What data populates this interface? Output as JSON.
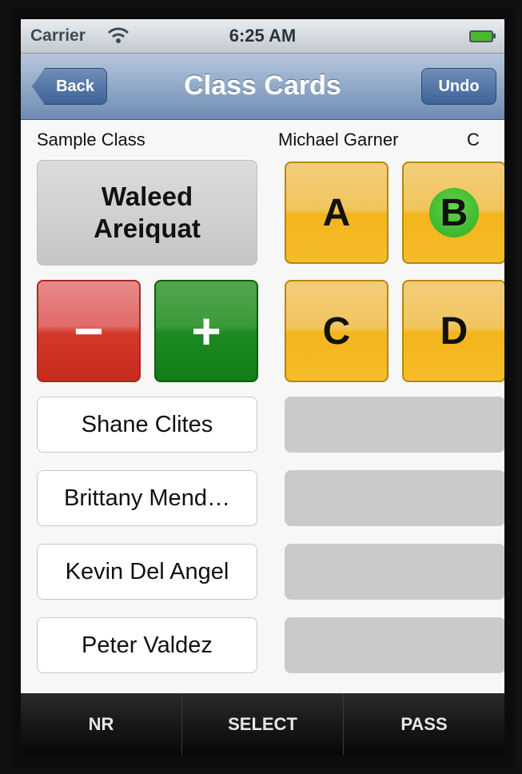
{
  "status_bar": {
    "carrier": "Carrier",
    "time": "6:25 AM"
  },
  "nav": {
    "back_label": "Back",
    "title": "Class Cards",
    "undo_label": "Undo"
  },
  "header": {
    "class_name": "Sample Class",
    "student_name": "Michael Garner",
    "grade": "C"
  },
  "current_student": {
    "name": "Waleed Areiquat"
  },
  "adjust": {
    "minus_label": "−",
    "plus_label": "+"
  },
  "grades": [
    {
      "label": "A",
      "selected": false
    },
    {
      "label": "B",
      "selected": true
    },
    {
      "label": "C",
      "selected": false
    },
    {
      "label": "D",
      "selected": false
    }
  ],
  "students": [
    {
      "name": "Shane Clites"
    },
    {
      "name": "Brittany Mend…"
    },
    {
      "name": "Kevin Del Angel"
    },
    {
      "name": "Peter Valdez"
    }
  ],
  "tabbar": {
    "nr_label": "NR",
    "select_label": "SELECT",
    "pass_label": "PASS"
  },
  "colors": {
    "grade_selected": "#2fae22",
    "grade_button": "#f3b51c",
    "minus": "#d33a2a",
    "plus": "#1e8a22"
  }
}
